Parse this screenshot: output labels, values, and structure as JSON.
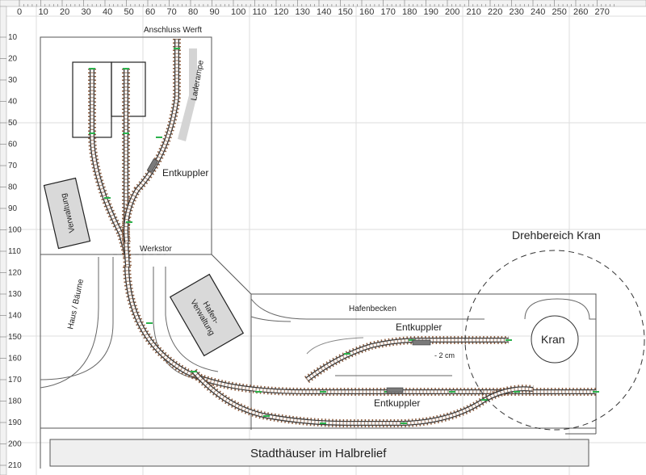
{
  "ruler": {
    "top_marks": [
      "0",
      "10",
      "20",
      "30",
      "40",
      "50",
      "60",
      "70",
      "80",
      "90",
      "100",
      "110",
      "120",
      "130",
      "140",
      "150",
      "160",
      "170",
      "180",
      "190",
      "200",
      "210",
      "220",
      "230",
      "240",
      "250",
      "260",
      "270"
    ],
    "left_marks": [
      "10",
      "20",
      "30",
      "40",
      "50",
      "60",
      "70",
      "80",
      "90",
      "100",
      "110",
      "120",
      "130",
      "140",
      "150",
      "160",
      "170",
      "180",
      "190",
      "200",
      "210"
    ]
  },
  "labels": {
    "anschluss_werft": "Anschluss Werft",
    "laderampe": "Laderampe",
    "entkuppler_werft": "Entkuppler",
    "verwaltung": "Verwaltung",
    "werkstor": "Werkstor",
    "haus_baeume": "Haus / Bäume",
    "hafen_verwaltung_1": "Hafen-",
    "hafen_verwaltung_2": "Verwaltung",
    "hafenbecken": "Hafenbecken",
    "entkuppler_upper": "Entkuppler",
    "note_2cm": "- 2 cm",
    "entkuppler_lower": "Entkuppler",
    "drehbereich": "Drehbereich Kran",
    "kran": "Kran",
    "stadthaeuser": "Stadthäuser im Halbrelief"
  },
  "colors": {
    "ruler_bg": "#f2f2f2",
    "grid": "#dddddd",
    "rail": "#3c3c3c",
    "sleeper": "#8a5a3c",
    "joint": "#2bb24c",
    "ramp": "#d4d4d4",
    "building": "#d9d9d9",
    "decoupler": "#7a7a7a"
  }
}
